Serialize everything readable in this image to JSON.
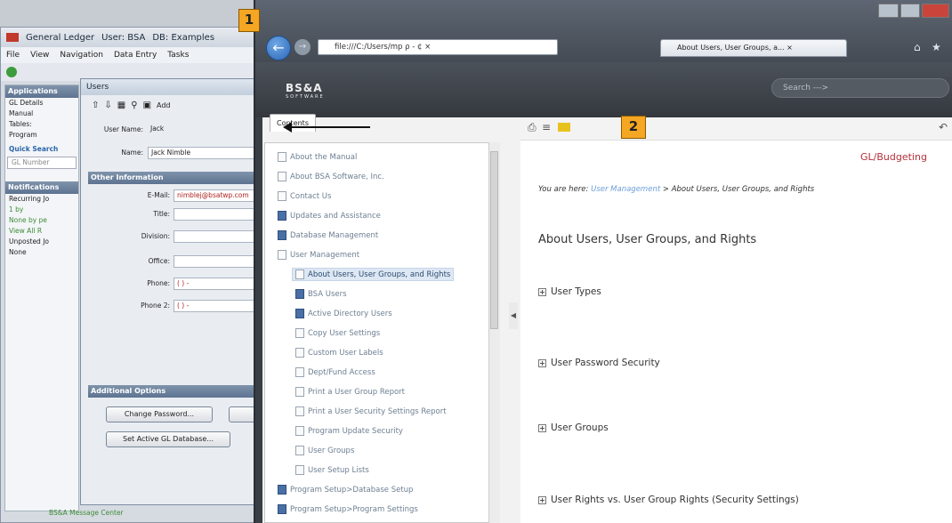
{
  "gl_window": {
    "title": "General Ledger",
    "user": "User: BSA",
    "db": "DB: Examples",
    "menu": [
      "File",
      "View",
      "Navigation",
      "Data Entry",
      "Tasks"
    ],
    "left_header": "Applications",
    "left_items": [
      "GL Details",
      "Manual",
      "Tables:",
      "Program"
    ],
    "quick_search": "Quick Search",
    "quick_field": "GL Number",
    "notifications": "Notifications",
    "recurring": "Recurring Jo",
    "r1": "1 by ",
    "r2": "None by pe",
    "r3": "View All R",
    "unposted": "Unposted Jo",
    "none": "None",
    "message_center": "BS&A Message Center"
  },
  "users_window": {
    "title": "Users",
    "add_label": "Add",
    "user_name_label": "User Name:",
    "user_name": "Jack",
    "name_label": "Name:",
    "name_value": "Jack Nimble",
    "other_info": "Other Information",
    "email_label": "E-Mail:",
    "email_value": "nimblej@bsatwp.com",
    "title_label": "Title:",
    "division_label": "Division:",
    "office_label": "Office:",
    "phone_label": "Phone:",
    "phone_value": "(  )  -",
    "phone2_label": "Phone 2:",
    "phone2_value": "(  )  -",
    "additional": "Additional Options",
    "change_pw": "Change Password...",
    "set_active": "Set Active GL Database..."
  },
  "browser": {
    "address": "file:///C:/Users/mp",
    "address_suffix": "ρ - ¢ ×",
    "tab_label": "About Users, User Groups, a... ×",
    "logo": "BS&A",
    "logo_sub": "SOFTWARE",
    "search_placeholder": "Search --->"
  },
  "contents_tab": "Contents",
  "toc": [
    "About the Manual",
    "About BSA Software, Inc.",
    "Contact Us",
    "Updates and Assistance",
    "Database Management",
    "User Management",
    "About Users, User Groups, and Rights",
    "BSA Users",
    "Active Directory Users",
    "Copy User Settings",
    "Custom User Labels",
    "Dept/Fund Access",
    "Print a User Group Report",
    "Print a User Security Settings Report",
    "Program Update Security",
    "User Groups",
    "User Setup Lists",
    "Program Setup>Database Setup",
    "Program Setup>Program Settings"
  ],
  "content": {
    "product": "GL/Budgeting",
    "you_are_here": "You are here:",
    "crumb_link": "User Management",
    "crumb_rest": "> About Users, User Groups, and Rights",
    "heading": "About Users, User Groups, and Rights",
    "sections": [
      "User Types",
      "User Password Security",
      "User Groups",
      "User Rights vs. User Group Rights (Security Settings)"
    ]
  },
  "callouts": [
    "1",
    "2"
  ]
}
